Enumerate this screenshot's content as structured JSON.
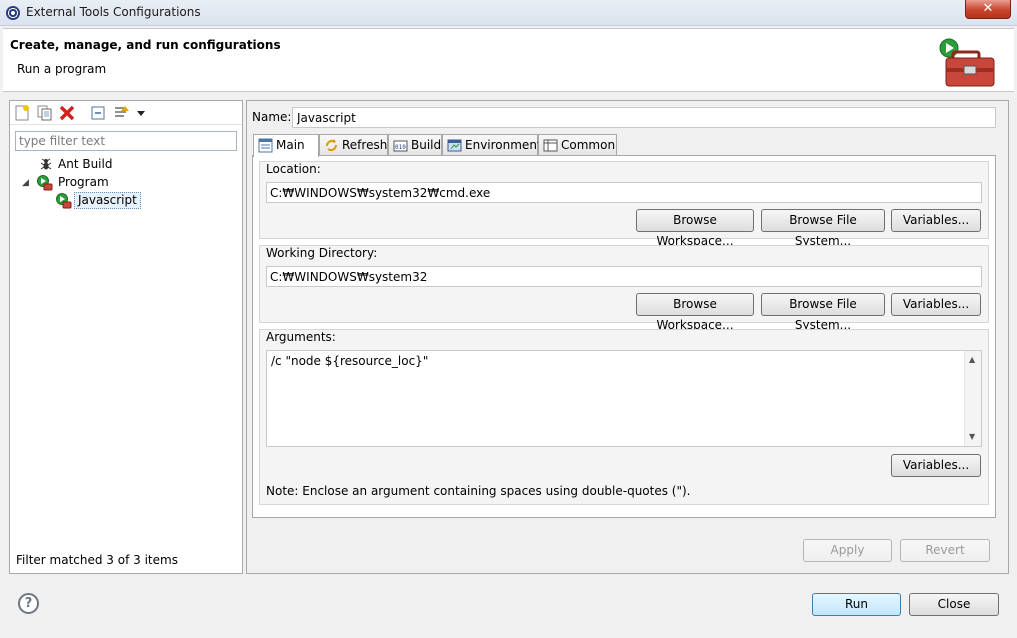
{
  "window": {
    "title": "External Tools Configurations",
    "close_glyph": "✕"
  },
  "header": {
    "title": "Create, manage, and run configurations",
    "subtitle": "Run a program"
  },
  "left_pane": {
    "filter_placeholder": "type filter text",
    "toolbar_icons": [
      "new-configuration-icon",
      "duplicate-icon",
      "delete-icon",
      "collapse-all-icon",
      "filter-icon",
      "dropdown-arrow-icon"
    ],
    "tree": [
      {
        "label": "Ant Build",
        "icon": "ant-icon",
        "level": 1
      },
      {
        "label": "Program",
        "icon": "program-icon",
        "level": 1,
        "expanded": true
      },
      {
        "label": "Javascript",
        "icon": "program-config-icon",
        "level": 2,
        "selected": true
      }
    ],
    "status": "Filter matched 3 of 3 items"
  },
  "right_pane": {
    "name_label": "Name:",
    "name_value": "Javascript",
    "tabs": [
      {
        "label": "Main",
        "icon": "main-tab-icon",
        "active": true
      },
      {
        "label": "Refresh",
        "icon": "refresh-icon"
      },
      {
        "label": "Build",
        "icon": "build-icon"
      },
      {
        "label": "Environment",
        "icon": "environment-icon"
      },
      {
        "label": "Common",
        "icon": "common-icon"
      }
    ],
    "location": {
      "label": "Location:",
      "value": "C:₩WINDOWS₩system32₩cmd.exe",
      "browse_workspace": "Browse Workspace...",
      "browse_fs": "Browse File System...",
      "variables": "Variables..."
    },
    "working_dir": {
      "label": "Working Directory:",
      "value": "C:₩WINDOWS₩system32",
      "browse_workspace": "Browse Workspace...",
      "browse_fs": "Browse File System...",
      "variables": "Variables..."
    },
    "arguments": {
      "label": "Arguments:",
      "value": "/c \"node ${resource_loc}\"",
      "variables": "Variables...",
      "note": "Note: Enclose an argument containing spaces using double-quotes (\")."
    },
    "apply": "Apply",
    "revert": "Revert"
  },
  "footer": {
    "help": "?",
    "run": "Run",
    "close": "Close"
  }
}
